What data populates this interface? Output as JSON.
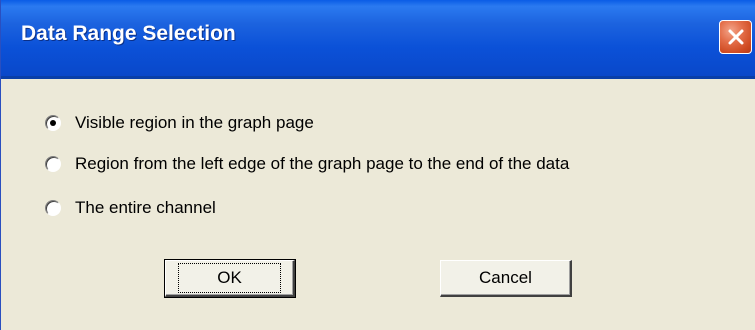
{
  "window": {
    "title": "Data Range Selection",
    "close_icon": "close-icon"
  },
  "options": [
    {
      "label": "Visible region in the graph page",
      "selected": true
    },
    {
      "label": "Region from the left edge of the graph page to the end of the data",
      "selected": false
    },
    {
      "label": "The entire channel",
      "selected": false
    }
  ],
  "buttons": {
    "ok_label": "OK",
    "cancel_label": "Cancel"
  },
  "colors": {
    "titlebar": "#0b51d8",
    "dialog_bg": "#ece9d8",
    "close_bg": "#cf4b22"
  }
}
